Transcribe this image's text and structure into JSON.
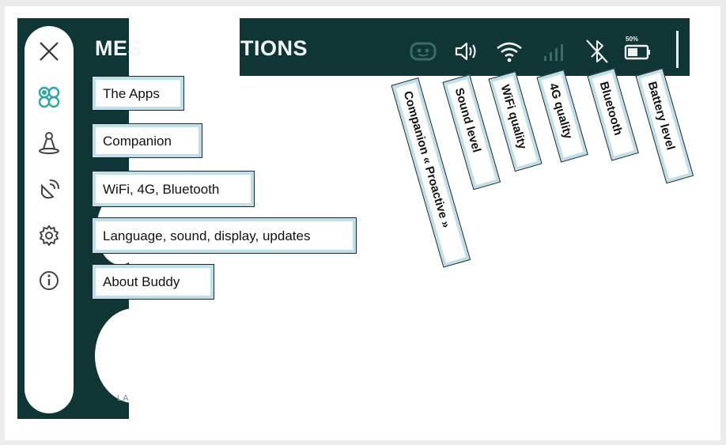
{
  "header": {
    "title_left": "MES",
    "title_right": "TIONS",
    "battery_label": "50%"
  },
  "status_icons": [
    "companion-face-icon",
    "speaker-icon",
    "wifi-icon",
    "cellular-signal-icon",
    "bluetooth-off-icon",
    "battery-icon"
  ],
  "menu": {
    "items": [
      {
        "icon": "close-icon",
        "callout": ""
      },
      {
        "icon": "apps-icon",
        "callout": "The Apps"
      },
      {
        "icon": "companion-icon",
        "callout": "Companion"
      },
      {
        "icon": "connectivity-icon",
        "callout": "WiFi, 4G, Bluetooth"
      },
      {
        "icon": "gear-icon",
        "callout": "Language, sound, display, updates"
      },
      {
        "icon": "info-icon",
        "callout": "About Buddy"
      }
    ]
  },
  "status_callouts": {
    "companion": "Companion « Proactive »",
    "sound": "Sound level",
    "wifi": "WiFi quality",
    "cellular": "4G quality",
    "bluetooth": "Bluetooth",
    "battery": "Battery level"
  },
  "truncated_label": "LA",
  "colors": {
    "dark_teal": "#0f3634",
    "callout_border": "#bfe0ea",
    "accent_teal": "#2fa6a0"
  }
}
